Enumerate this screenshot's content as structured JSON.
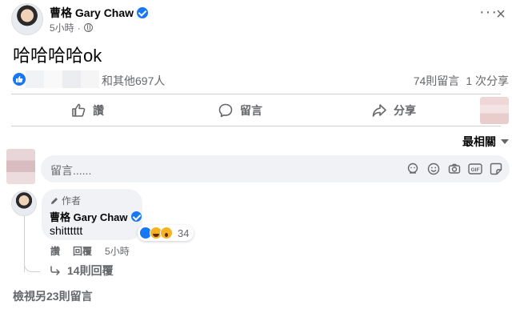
{
  "post": {
    "author": "曹格 Gary Chaw",
    "time": "5小時",
    "text": "哈哈哈哈ok",
    "reaction_summary": "和其他697人",
    "comments_count": "74則留言",
    "shares_count": "1 次分享"
  },
  "actions": {
    "like": "讚",
    "comment": "留言",
    "share": "分享"
  },
  "sort": {
    "label": "最相關"
  },
  "composer": {
    "placeholder": "留言......"
  },
  "comment": {
    "author_tag": "作者",
    "author": "曹格 Gary Chaw",
    "text": "shitttttt",
    "reaction_count": "34",
    "like_label": "讚",
    "reply_label": "回覆",
    "time": "5小時",
    "replies_label": "14則回覆"
  },
  "view_more": "檢視另23則留言",
  "colors": {
    "brand_blue": "#1877f2",
    "secondary_text": "#65676b",
    "composer_bg": "#f0f2f5"
  }
}
